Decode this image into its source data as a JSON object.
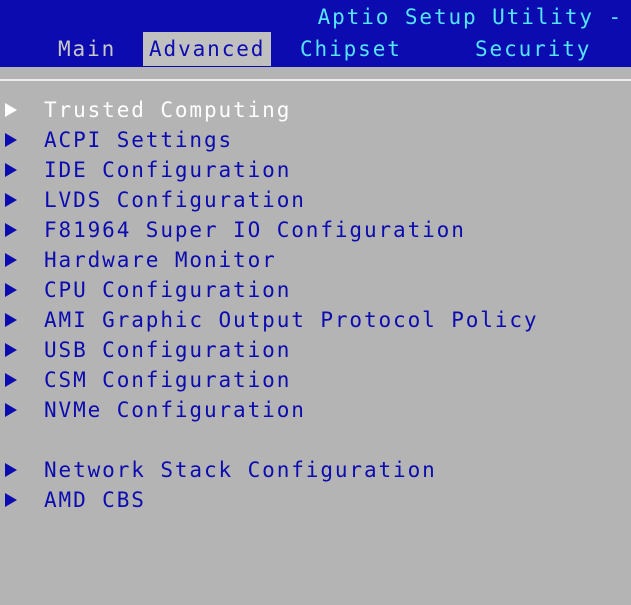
{
  "app": {
    "title": "Aptio Setup Utility -"
  },
  "tabs": [
    {
      "label": "Main"
    },
    {
      "label": "Advanced"
    },
    {
      "label": "Chipset"
    },
    {
      "label": "Security"
    }
  ],
  "menu": {
    "items": [
      {
        "label": "Trusted Computing"
      },
      {
        "label": "ACPI Settings"
      },
      {
        "label": "IDE Configuration"
      },
      {
        "label": "LVDS Configuration"
      },
      {
        "label": "F81964 Super IO Configuration"
      },
      {
        "label": "Hardware Monitor"
      },
      {
        "label": "CPU Configuration"
      },
      {
        "label": "AMI Graphic Output Protocol Policy"
      },
      {
        "label": "USB Configuration"
      },
      {
        "label": "CSM Configuration"
      },
      {
        "label": "NVMe Configuration"
      },
      {
        "label": "Network Stack Configuration"
      },
      {
        "label": "AMD CBS"
      }
    ]
  },
  "colors": {
    "header_bg": "#0b0bb0",
    "body_bg": "#b4b4b4",
    "highlight_text": "#ffffff",
    "menu_text": "#0b0bb0",
    "title_text": "#55e5ff"
  }
}
